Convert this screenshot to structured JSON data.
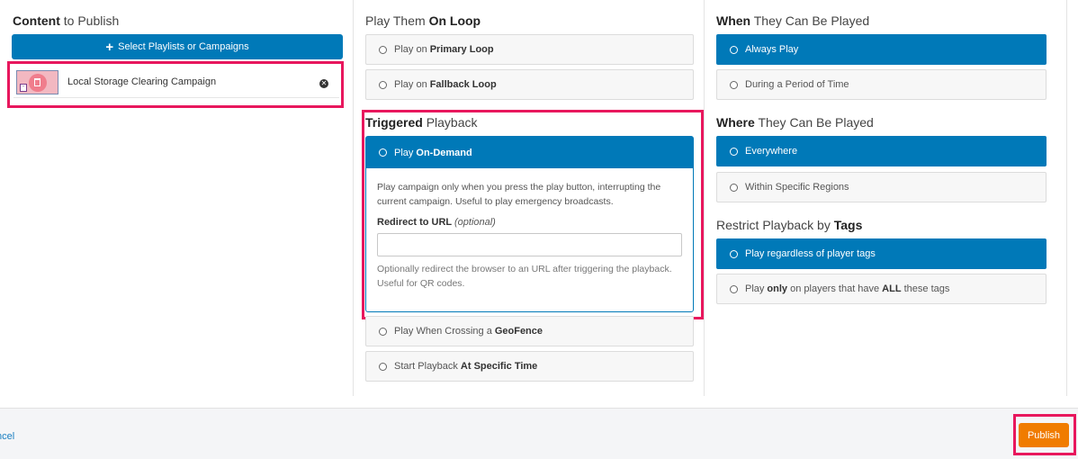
{
  "content": {
    "heading_bold": "Content",
    "heading_rest": "to Publish",
    "select_button": "Select Playlists or Campaigns",
    "item": {
      "title": "Local Storage Clearing Campaign"
    }
  },
  "loop": {
    "heading_pre": "Play Them",
    "heading_bold": "On Loop",
    "primary_pre": "Play on",
    "primary_bold": "Primary Loop",
    "fallback_pre": "Play on",
    "fallback_bold": "Fallback Loop"
  },
  "triggered": {
    "heading_bold": "Triggered",
    "heading_rest": "Playback",
    "ondemand_pre": "Play",
    "ondemand_bold": "On-Demand",
    "description": "Play campaign only when you press the play button, interrupting the current campaign. Useful to play emergency broadcasts.",
    "redirect_label": "Redirect to URL",
    "redirect_optional": "(optional)",
    "redirect_value": "",
    "redirect_help": "Optionally redirect the browser to an URL after triggering the playback. Useful for QR codes.",
    "geofence_pre": "Play When Crossing a",
    "geofence_bold": "GeoFence",
    "time_pre": "Start Playback",
    "time_bold": "At Specific Time"
  },
  "when": {
    "heading_bold": "When",
    "heading_rest": "They Can Be Played",
    "always": "Always Play",
    "period": "During a Period of Time"
  },
  "where": {
    "heading_bold": "Where",
    "heading_rest": "They Can Be Played",
    "everywhere": "Everywhere",
    "regions": "Within Specific Regions"
  },
  "tags": {
    "heading_pre": "Restrict Playback by",
    "heading_bold": "Tags",
    "regardless": "Play regardless of player tags",
    "only_pre": "Play",
    "only_bold": "only",
    "only_mid": "on players that have",
    "only_bold2": "ALL",
    "only_post": "these tags"
  },
  "footer": {
    "cancel": "ncel",
    "publish": "Publish"
  },
  "colors": {
    "primary": "#0079b8",
    "publish": "#f07c00",
    "highlight": "#e8175d"
  }
}
